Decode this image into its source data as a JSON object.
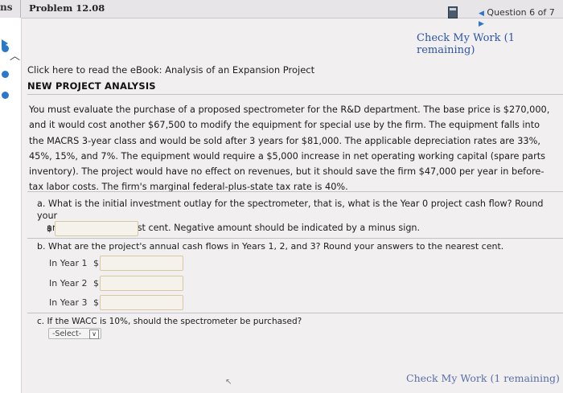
{
  "topbar": {
    "cut_label": "ns",
    "problem_title": "Problem 12.08",
    "question_nav": "Question 6 of 7",
    "prev_arrow": "◀",
    "next_arrow": "▶"
  },
  "check_my_work_top": "Check My Work (1 remaining)",
  "ebook_link": "Click here to read the eBook: Analysis of an Expansion Project",
  "section_heading": "NEW PROJECT ANALYSIS",
  "problem_text": "You must evaluate the purchase of a proposed spectrometer for the R&D department. The base price is $270,000, and it would cost another $67,500 to modify the equipment for special use by the firm. The equipment falls into the MACRS 3-year class and would be sold after 3 years for $81,000. The applicable depreciation rates are 33%, 45%, 15%, and 7%. The equipment would require a $5,000 increase in net operating working capital (spare parts inventory). The project would have no effect on revenues, but it should save the firm $47,000 per year in before-tax labor costs. The firm's marginal federal-plus-state tax rate is 40%.",
  "question_a": {
    "label": "a.",
    "line1": "What is the initial investment outlay for the spectrometer, that is, what is the Year 0 project cash flow? Round your",
    "line2": "answer to the nearest cent. Negative amount should be indicated by a minus sign.",
    "currency": "$",
    "value": ""
  },
  "question_b": {
    "text": "b. What are the project's annual cash flows in Years 1, 2, and 3? Round your answers to the nearest cent.",
    "years": [
      {
        "label": "In Year 1",
        "currency": "$",
        "value": ""
      },
      {
        "label": "In Year 2",
        "currency": "$",
        "value": ""
      },
      {
        "label": "In Year 3",
        "currency": "$",
        "value": ""
      }
    ]
  },
  "question_c": {
    "text": "c. If the WACC is 10%, should the spectrometer be purchased?",
    "select_value": "-Select-",
    "select_arrow": "∨"
  },
  "check_my_work_bottom": "Check My Work (1 remaining)",
  "colors": {
    "link_blue": "#2d55a3",
    "accent_blue": "#2b77c9",
    "input_border": "#d8c8a2"
  }
}
